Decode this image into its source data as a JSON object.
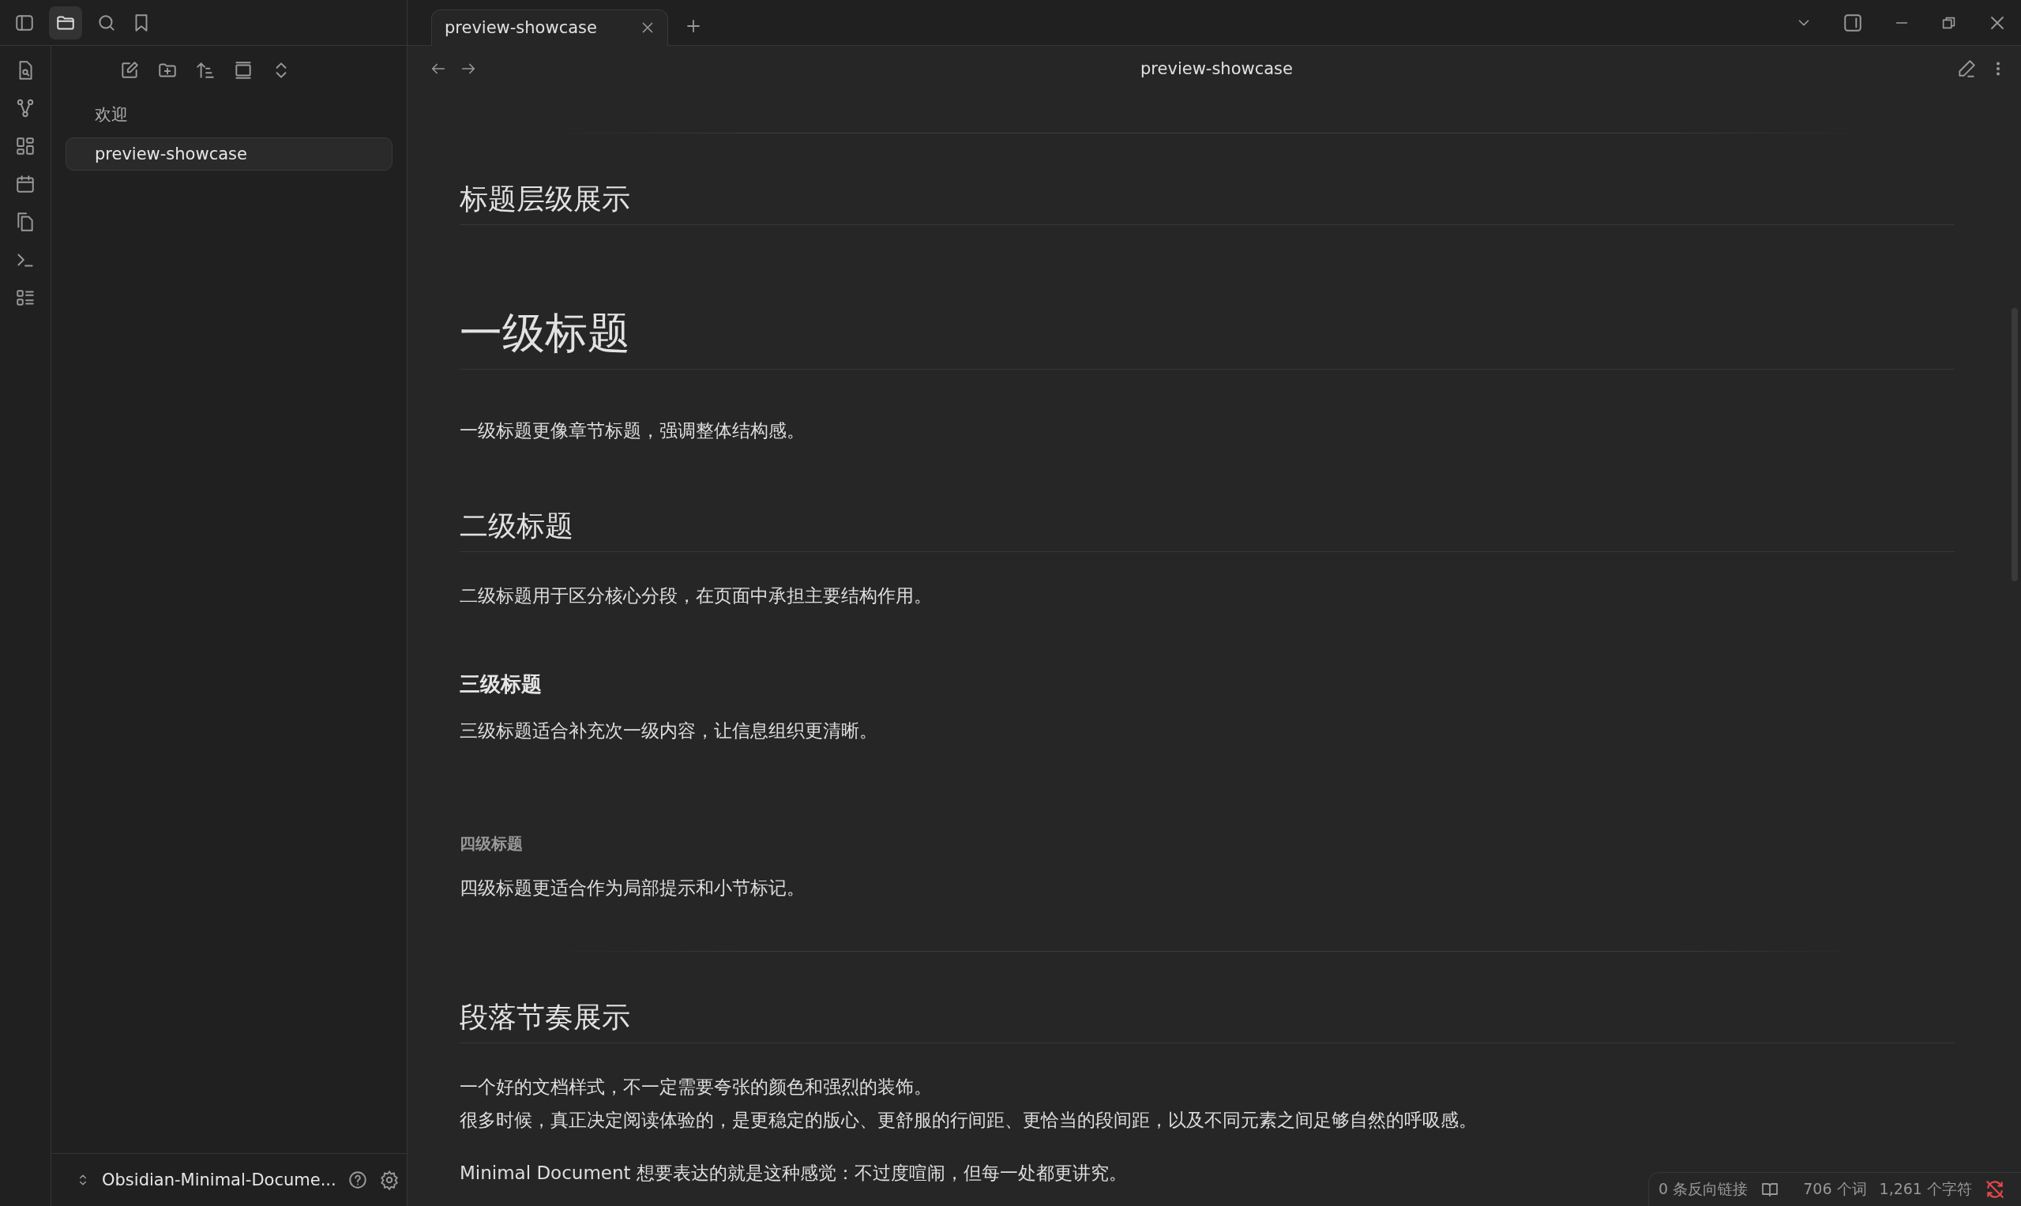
{
  "files": [
    {
      "label": "欢迎",
      "selected": false
    },
    {
      "label": "preview-showcase",
      "selected": true
    }
  ],
  "vault": {
    "name": "Obsidian-Minimal-Docume..."
  },
  "tabs": [
    {
      "label": "preview-showcase",
      "selected": true
    }
  ],
  "view_title": "preview-showcase",
  "document": [
    {
      "kind": "hr"
    },
    {
      "kind": "h2",
      "text": "标题层级展示"
    },
    {
      "kind": "h1",
      "text": "一级标题"
    },
    {
      "kind": "p",
      "lines": [
        "一级标题更像章节标题，强调整体结构感。"
      ]
    },
    {
      "kind": "h2",
      "text": "二级标题"
    },
    {
      "kind": "p",
      "lines": [
        "二级标题用于区分核心分段，在页面中承担主要结构作用。"
      ]
    },
    {
      "kind": "h3",
      "text": "三级标题"
    },
    {
      "kind": "p",
      "lines": [
        "三级标题适合补充次一级内容，让信息组织更清晰。"
      ]
    },
    {
      "kind": "h4",
      "text": "四级标题"
    },
    {
      "kind": "p",
      "lines": [
        "四级标题更适合作为局部提示和小节标记。"
      ]
    },
    {
      "kind": "hr"
    },
    {
      "kind": "h2",
      "text": "段落节奏展示"
    },
    {
      "kind": "p",
      "lines": [
        "一个好的文档样式，不一定需要夸张的颜色和强烈的装饰。",
        "很多时候，真正决定阅读体验的，是更稳定的版心、更舒服的行间距、更恰当的段间距，以及不同元素之间足够自然的呼吸感。"
      ]
    },
    {
      "kind": "p",
      "lines": [
        "Minimal Document 想要表达的就是这种感觉：不过度喧闹，但每一处都更讲究。"
      ]
    }
  ],
  "status_bar": {
    "backlinks": "0 条反向链接",
    "words": "706 个词",
    "characters": "1,261 个字符"
  }
}
